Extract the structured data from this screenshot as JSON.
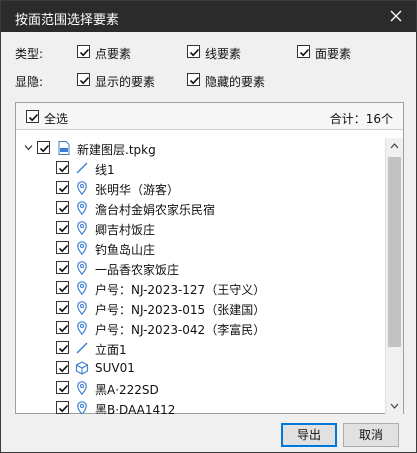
{
  "window": {
    "title": "按面范围选择要素"
  },
  "types": {
    "label": "类型:",
    "options": [
      {
        "label": "点要素",
        "checked": true
      },
      {
        "label": "线要素",
        "checked": true
      },
      {
        "label": "面要素",
        "checked": true
      }
    ]
  },
  "visibility": {
    "label": "显隐:",
    "options": [
      {
        "label": "显示的要素",
        "checked": true
      },
      {
        "label": "隐藏的要素",
        "checked": true
      }
    ]
  },
  "panel": {
    "select_all": "全选",
    "total": "合计：16个",
    "root": {
      "label": "新建图层.tpkg",
      "icon": "layer-package-icon",
      "expanded": true
    },
    "items": [
      {
        "label": "线1",
        "icon": "line-icon"
      },
      {
        "label": "张明华（游客）",
        "icon": "location-pin-icon"
      },
      {
        "label": "澹台村金娟农家乐民宿",
        "icon": "location-pin-icon"
      },
      {
        "label": "卿吉村饭庄",
        "icon": "location-pin-icon"
      },
      {
        "label": "钓鱼岛山庄",
        "icon": "location-pin-icon"
      },
      {
        "label": "一品香农家饭庄",
        "icon": "location-pin-icon"
      },
      {
        "label": "户号：NJ-2023-127（王守义）",
        "icon": "location-pin-icon"
      },
      {
        "label": "户号：NJ-2023-015（张建国）",
        "icon": "location-pin-icon"
      },
      {
        "label": "户号：NJ-2023-042（李富民）",
        "icon": "location-pin-icon"
      },
      {
        "label": "立面1",
        "icon": "line-icon"
      },
      {
        "label": "SUV01",
        "icon": "cube-icon"
      },
      {
        "label": "黑A·222SD",
        "icon": "location-pin-icon"
      },
      {
        "label": "黑B·DAA1412",
        "icon": "location-pin-icon"
      }
    ]
  },
  "buttons": {
    "export": "导出",
    "cancel": "取消"
  },
  "colors": {
    "titlebar": "#2b2b2b",
    "accent": "#0078d7",
    "icon_blue": "#3b7fd0"
  }
}
